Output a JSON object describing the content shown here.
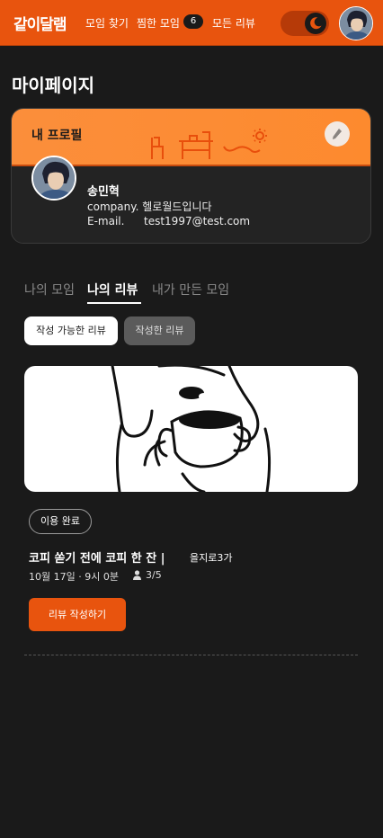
{
  "header": {
    "logo": "같이달램",
    "nav": {
      "find": "모임 찾기",
      "favorites": "찜한 모임",
      "favorites_count": "6",
      "reviews": "모든 리뷰"
    },
    "toggle_icon": "moon-icon"
  },
  "page": {
    "title": "마이페이지"
  },
  "profile": {
    "card_label": "내 프로필",
    "name": "송민혁",
    "company_label": "company.",
    "company": "헬로월드입니다",
    "email_label": "E-mail.",
    "email": "test1997@test.com"
  },
  "tabs": [
    {
      "label": "나의 모임",
      "active": false
    },
    {
      "label": "나의 리뷰",
      "active": true
    },
    {
      "label": "내가 만든 모임",
      "active": false
    }
  ],
  "filters": [
    {
      "label": "작성 가능한 리뷰",
      "active": true
    },
    {
      "label": "작성한 리뷰",
      "active": false
    }
  ],
  "meeting": {
    "status": "이용 완료",
    "title": "코피 쏟기 전에 코피 한 잔",
    "separator": "|",
    "location": "을지로3가",
    "datetime": "10월 17일 · 9시 0분",
    "participants": "3/5",
    "review_button": "리뷰 작성하기"
  },
  "colors": {
    "accent": "#e8540e",
    "banner": "#fd8a2e",
    "background": "#1a1a1a"
  }
}
